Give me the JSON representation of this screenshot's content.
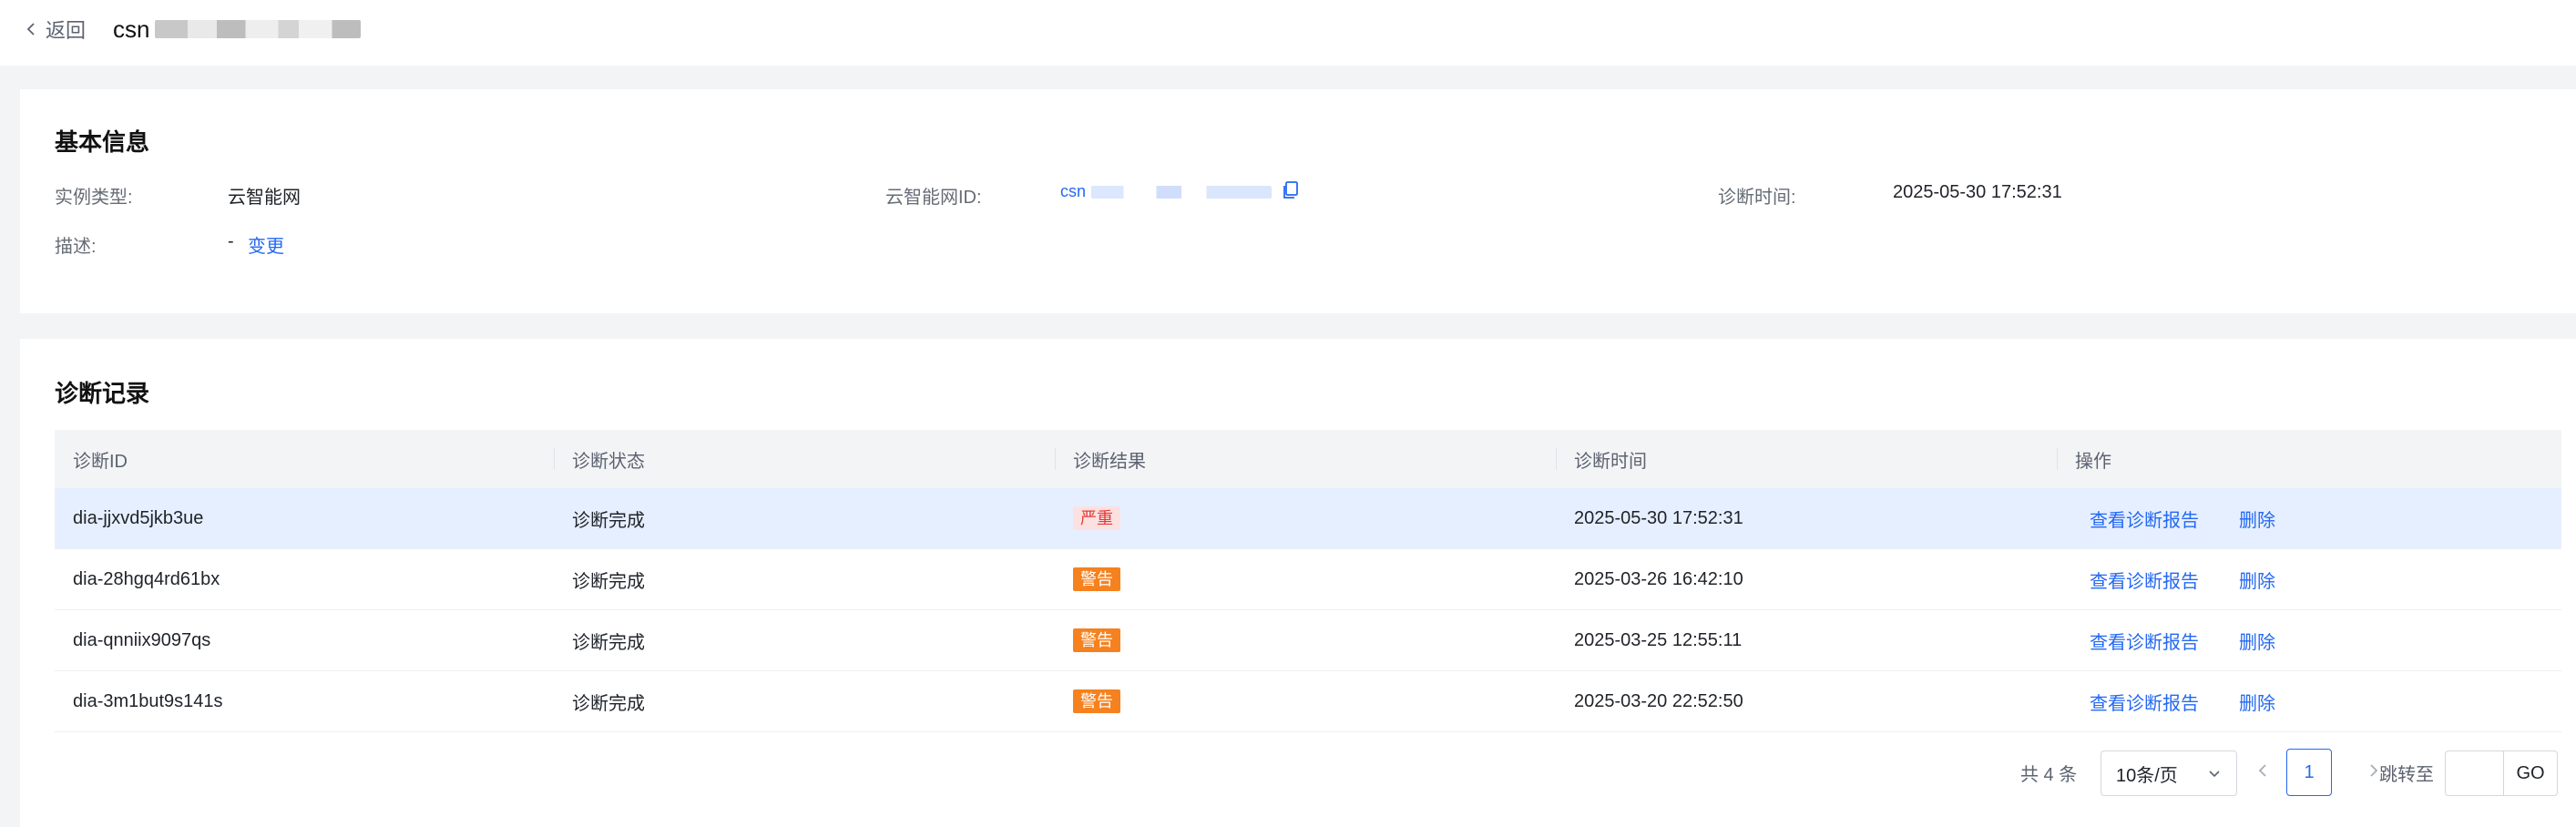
{
  "header": {
    "back_label": "返回",
    "title": "csn"
  },
  "basic_info": {
    "title": "基本信息",
    "instance_type_label": "实例类型:",
    "instance_type_value": "云智能网",
    "csn_id_label": "云智能网ID:",
    "csn_id_value": "csn",
    "diag_time_label": "诊断时间:",
    "diag_time_value": "2025-05-30 17:52:31",
    "desc_label": "描述:",
    "desc_value": "-",
    "desc_change": "变更"
  },
  "records": {
    "title": "诊断记录",
    "columns": [
      "诊断ID",
      "诊断状态",
      "诊断结果",
      "诊断时间",
      "操作"
    ],
    "rows": [
      {
        "id": "dia-jjxvd5jkb3ue",
        "status": "诊断完成",
        "result": "严重",
        "result_level": "danger",
        "time": "2025-05-30 17:52:31",
        "view": "查看诊断报告",
        "delete": "删除"
      },
      {
        "id": "dia-28hgq4rd61bx",
        "status": "诊断完成",
        "result": "警告",
        "result_level": "warn",
        "time": "2025-03-26 16:42:10",
        "view": "查看诊断报告",
        "delete": "删除"
      },
      {
        "id": "dia-qnniix9097qs",
        "status": "诊断完成",
        "result": "警告",
        "result_level": "warn",
        "time": "2025-03-25 12:55:11",
        "view": "查看诊断报告",
        "delete": "删除"
      },
      {
        "id": "dia-3m1but9s141s",
        "status": "诊断完成",
        "result": "警告",
        "result_level": "warn",
        "time": "2025-03-20 22:52:50",
        "view": "查看诊断报告",
        "delete": "删除"
      }
    ]
  },
  "pagination": {
    "total": "共 4 条",
    "page_size": "10条/页",
    "current_page": "1",
    "jump_label": "跳转至",
    "go_label": "GO"
  },
  "colors": {
    "accent": "#2468f2",
    "danger": "#e53935",
    "warn": "#f5811f",
    "selected_row": "#e6efff"
  }
}
